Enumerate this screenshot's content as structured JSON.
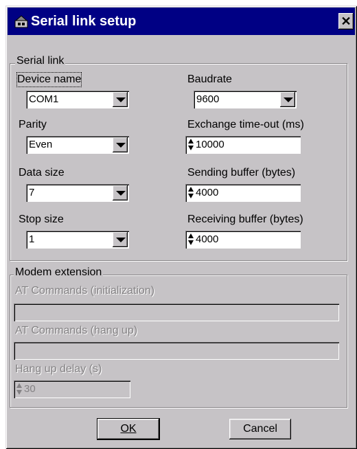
{
  "window": {
    "title": "Serial link setup",
    "close_label": "✕",
    "icon": "app-icon"
  },
  "serial_link": {
    "group_label": "Serial link",
    "device_name": {
      "label": "Device name",
      "value": "COM1"
    },
    "baudrate": {
      "label": "Baudrate",
      "value": "9600"
    },
    "parity": {
      "label": "Parity",
      "value": "Even"
    },
    "exchange_timeout": {
      "label": "Exchange time-out (ms)",
      "value": "10000"
    },
    "data_size": {
      "label": "Data size",
      "value": "7"
    },
    "sending_buffer": {
      "label": "Sending buffer (bytes)",
      "value": "4000"
    },
    "stop_size": {
      "label": "Stop size",
      "value": "1"
    },
    "receiving_buffer": {
      "label": "Receiving buffer (bytes)",
      "value": "4000"
    }
  },
  "modem_extension": {
    "group_label": "Modem extension",
    "at_init": {
      "label": "AT Commands (initialization)",
      "value": ""
    },
    "at_hangup": {
      "label": "AT Commands (hang up)",
      "value": ""
    },
    "hangup_delay": {
      "label": "Hang up delay (s)",
      "value": "30"
    }
  },
  "buttons": {
    "ok": "OK",
    "cancel": "Cancel"
  },
  "colors": {
    "titlebar": "#000084",
    "face": "#c6c3c6",
    "disabled_text": "#848284"
  }
}
